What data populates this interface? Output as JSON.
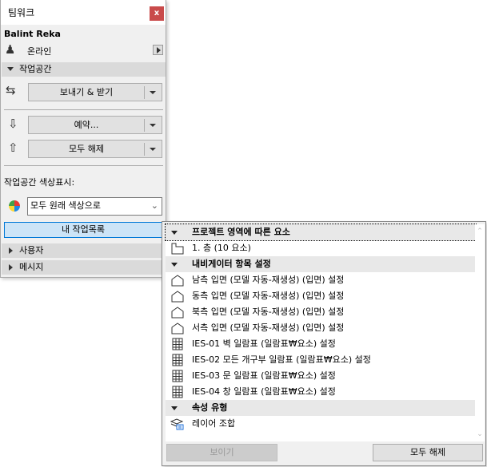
{
  "palette": {
    "title": "팀워크",
    "close": "x",
    "user": "Balint Reka",
    "status": "온라인",
    "workspace": {
      "header": "작업공간",
      "send_receive": "보내기 & 받기",
      "reserve": "예약...",
      "release_all": "모두 해제",
      "color_label": "작업공간 색상표시:",
      "color_select": "모두 원래 색상으로",
      "my_worklist": "내 작업목록"
    },
    "users": "사용자",
    "messages": "메시지"
  },
  "popup": {
    "groups": [
      {
        "header": "프로젝트 영역에 따른 요소",
        "items": [
          {
            "icon": "story-icon",
            "label": "1. 층 (10 요소)"
          }
        ]
      },
      {
        "header": "내비게이터 항목 설정",
        "items": [
          {
            "icon": "elevation-icon",
            "label": "남측 입면 (모델 자동-재생성) (입면) 설정"
          },
          {
            "icon": "elevation-icon",
            "label": "동측 입면 (모델 자동-재생성) (입면) 설정"
          },
          {
            "icon": "elevation-icon",
            "label": "북측 입면 (모델 자동-재생성) (입면) 설정"
          },
          {
            "icon": "elevation-icon",
            "label": "서측 입면 (모델 자동-재생성) (입면) 설정"
          },
          {
            "icon": "schedule-icon",
            "label": "IES-01 벽 일람표 (일람표₩요소) 설정"
          },
          {
            "icon": "schedule-icon",
            "label": "IES-02 모든 개구부 일람표 (일람표₩요소) 설정"
          },
          {
            "icon": "schedule-icon",
            "label": "IES-03 문 일람표 (일람표₩요소) 설정"
          },
          {
            "icon": "schedule-icon",
            "label": "IES-04 창 일람표 (일람표₩요소) 설정"
          }
        ]
      },
      {
        "header": "속성 유형",
        "items": [
          {
            "icon": "layer-combination-icon",
            "label": "레이어 조합"
          }
        ]
      }
    ],
    "show": "보이기",
    "release_all": "모두 해제"
  }
}
